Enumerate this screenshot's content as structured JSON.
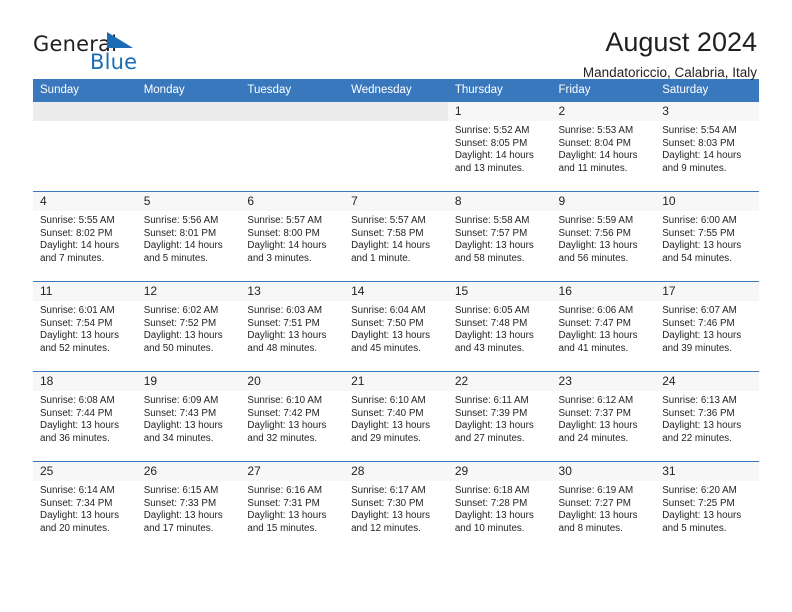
{
  "brand": {
    "name_part1": "General",
    "name_part2": "Blue",
    "flag_icon": "triangle-flag-icon"
  },
  "header": {
    "title": "August 2024",
    "subtitle": "Mandatoriccio, Calabria, Italy"
  },
  "calendar": {
    "weekday_headers": [
      "Sunday",
      "Monday",
      "Tuesday",
      "Wednesday",
      "Thursday",
      "Friday",
      "Saturday"
    ],
    "accent_color": "#3a78be",
    "header_text_color": "#ffffff",
    "daynum_band_color": "#ececec",
    "weeks": [
      [
        {
          "day": "",
          "empty": true,
          "lines": []
        },
        {
          "day": "",
          "empty": true,
          "lines": []
        },
        {
          "day": "",
          "empty": true,
          "lines": []
        },
        {
          "day": "",
          "empty": true,
          "lines": []
        },
        {
          "day": "1",
          "empty": false,
          "lines": [
            "Sunrise: 5:52 AM",
            "Sunset: 8:05 PM",
            "Daylight: 14 hours",
            "and 13 minutes."
          ]
        },
        {
          "day": "2",
          "empty": false,
          "lines": [
            "Sunrise: 5:53 AM",
            "Sunset: 8:04 PM",
            "Daylight: 14 hours",
            "and 11 minutes."
          ]
        },
        {
          "day": "3",
          "empty": false,
          "lines": [
            "Sunrise: 5:54 AM",
            "Sunset: 8:03 PM",
            "Daylight: 14 hours",
            "and 9 minutes."
          ]
        }
      ],
      [
        {
          "day": "4",
          "empty": false,
          "lines": [
            "Sunrise: 5:55 AM",
            "Sunset: 8:02 PM",
            "Daylight: 14 hours",
            "and 7 minutes."
          ]
        },
        {
          "day": "5",
          "empty": false,
          "lines": [
            "Sunrise: 5:56 AM",
            "Sunset: 8:01 PM",
            "Daylight: 14 hours",
            "and 5 minutes."
          ]
        },
        {
          "day": "6",
          "empty": false,
          "lines": [
            "Sunrise: 5:57 AM",
            "Sunset: 8:00 PM",
            "Daylight: 14 hours",
            "and 3 minutes."
          ]
        },
        {
          "day": "7",
          "empty": false,
          "lines": [
            "Sunrise: 5:57 AM",
            "Sunset: 7:58 PM",
            "Daylight: 14 hours",
            "and 1 minute."
          ]
        },
        {
          "day": "8",
          "empty": false,
          "lines": [
            "Sunrise: 5:58 AM",
            "Sunset: 7:57 PM",
            "Daylight: 13 hours",
            "and 58 minutes."
          ]
        },
        {
          "day": "9",
          "empty": false,
          "lines": [
            "Sunrise: 5:59 AM",
            "Sunset: 7:56 PM",
            "Daylight: 13 hours",
            "and 56 minutes."
          ]
        },
        {
          "day": "10",
          "empty": false,
          "lines": [
            "Sunrise: 6:00 AM",
            "Sunset: 7:55 PM",
            "Daylight: 13 hours",
            "and 54 minutes."
          ]
        }
      ],
      [
        {
          "day": "11",
          "empty": false,
          "lines": [
            "Sunrise: 6:01 AM",
            "Sunset: 7:54 PM",
            "Daylight: 13 hours",
            "and 52 minutes."
          ]
        },
        {
          "day": "12",
          "empty": false,
          "lines": [
            "Sunrise: 6:02 AM",
            "Sunset: 7:52 PM",
            "Daylight: 13 hours",
            "and 50 minutes."
          ]
        },
        {
          "day": "13",
          "empty": false,
          "lines": [
            "Sunrise: 6:03 AM",
            "Sunset: 7:51 PM",
            "Daylight: 13 hours",
            "and 48 minutes."
          ]
        },
        {
          "day": "14",
          "empty": false,
          "lines": [
            "Sunrise: 6:04 AM",
            "Sunset: 7:50 PM",
            "Daylight: 13 hours",
            "and 45 minutes."
          ]
        },
        {
          "day": "15",
          "empty": false,
          "lines": [
            "Sunrise: 6:05 AM",
            "Sunset: 7:48 PM",
            "Daylight: 13 hours",
            "and 43 minutes."
          ]
        },
        {
          "day": "16",
          "empty": false,
          "lines": [
            "Sunrise: 6:06 AM",
            "Sunset: 7:47 PM",
            "Daylight: 13 hours",
            "and 41 minutes."
          ]
        },
        {
          "day": "17",
          "empty": false,
          "lines": [
            "Sunrise: 6:07 AM",
            "Sunset: 7:46 PM",
            "Daylight: 13 hours",
            "and 39 minutes."
          ]
        }
      ],
      [
        {
          "day": "18",
          "empty": false,
          "lines": [
            "Sunrise: 6:08 AM",
            "Sunset: 7:44 PM",
            "Daylight: 13 hours",
            "and 36 minutes."
          ]
        },
        {
          "day": "19",
          "empty": false,
          "lines": [
            "Sunrise: 6:09 AM",
            "Sunset: 7:43 PM",
            "Daylight: 13 hours",
            "and 34 minutes."
          ]
        },
        {
          "day": "20",
          "empty": false,
          "lines": [
            "Sunrise: 6:10 AM",
            "Sunset: 7:42 PM",
            "Daylight: 13 hours",
            "and 32 minutes."
          ]
        },
        {
          "day": "21",
          "empty": false,
          "lines": [
            "Sunrise: 6:10 AM",
            "Sunset: 7:40 PM",
            "Daylight: 13 hours",
            "and 29 minutes."
          ]
        },
        {
          "day": "22",
          "empty": false,
          "lines": [
            "Sunrise: 6:11 AM",
            "Sunset: 7:39 PM",
            "Daylight: 13 hours",
            "and 27 minutes."
          ]
        },
        {
          "day": "23",
          "empty": false,
          "lines": [
            "Sunrise: 6:12 AM",
            "Sunset: 7:37 PM",
            "Daylight: 13 hours",
            "and 24 minutes."
          ]
        },
        {
          "day": "24",
          "empty": false,
          "lines": [
            "Sunrise: 6:13 AM",
            "Sunset: 7:36 PM",
            "Daylight: 13 hours",
            "and 22 minutes."
          ]
        }
      ],
      [
        {
          "day": "25",
          "empty": false,
          "lines": [
            "Sunrise: 6:14 AM",
            "Sunset: 7:34 PM",
            "Daylight: 13 hours",
            "and 20 minutes."
          ]
        },
        {
          "day": "26",
          "empty": false,
          "lines": [
            "Sunrise: 6:15 AM",
            "Sunset: 7:33 PM",
            "Daylight: 13 hours",
            "and 17 minutes."
          ]
        },
        {
          "day": "27",
          "empty": false,
          "lines": [
            "Sunrise: 6:16 AM",
            "Sunset: 7:31 PM",
            "Daylight: 13 hours",
            "and 15 minutes."
          ]
        },
        {
          "day": "28",
          "empty": false,
          "lines": [
            "Sunrise: 6:17 AM",
            "Sunset: 7:30 PM",
            "Daylight: 13 hours",
            "and 12 minutes."
          ]
        },
        {
          "day": "29",
          "empty": false,
          "lines": [
            "Sunrise: 6:18 AM",
            "Sunset: 7:28 PM",
            "Daylight: 13 hours",
            "and 10 minutes."
          ]
        },
        {
          "day": "30",
          "empty": false,
          "lines": [
            "Sunrise: 6:19 AM",
            "Sunset: 7:27 PM",
            "Daylight: 13 hours",
            "and 8 minutes."
          ]
        },
        {
          "day": "31",
          "empty": false,
          "lines": [
            "Sunrise: 6:20 AM",
            "Sunset: 7:25 PM",
            "Daylight: 13 hours",
            "and 5 minutes."
          ]
        }
      ]
    ]
  }
}
